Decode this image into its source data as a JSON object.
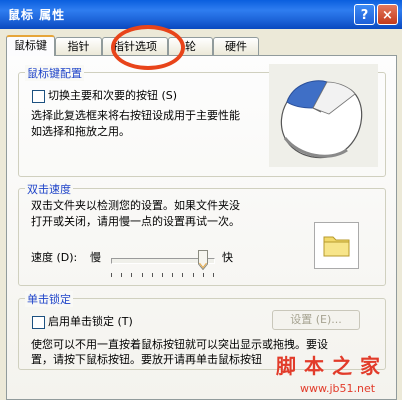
{
  "window": {
    "title": "鼠标 属性",
    "help_button": "?",
    "close_button": "×"
  },
  "tabs": [
    {
      "label": "鼠标键",
      "active": true
    },
    {
      "label": "指针",
      "active": false
    },
    {
      "label": "指针选项",
      "active": false
    },
    {
      "label": "轮",
      "active": false
    },
    {
      "label": "硬件",
      "active": false
    }
  ],
  "buttons_config": {
    "legend": "鼠标键配置",
    "swap_checkbox_label": "切换主要和次要的按钮 (S)",
    "swap_checked": false,
    "desc_line1": "选择此复选框来将右按钮设成用于主要性能",
    "desc_line2": "如选择和拖放之用。"
  },
  "double_click": {
    "legend": "双击速度",
    "desc_line1": "双击文件夹以检测您的设置。如果文件夹没",
    "desc_line2": "打开或关闭，请用慢一点的设置再试一次。",
    "speed_label": "速度 (D):",
    "slow_label": "慢",
    "fast_label": "快",
    "speed_level": 0.9
  },
  "click_lock": {
    "legend": "单击锁定",
    "checkbox_label": "启用单击锁定 (T)",
    "checked": false,
    "settings_button": "设置 (E)...",
    "desc_line1": "使您可以不用一直按着鼠标按钮就可以突出显示或拖拽。要设",
    "desc_line2": "置，请按下鼠标按钮。要放开请再单击鼠标按钮"
  },
  "watermark": {
    "brand": "脚本之家",
    "url": "www.jb51.net"
  },
  "colors": {
    "title_bar": "#0a5fde",
    "legend_text": "#1f44c9",
    "annotation_circle": "#e8441a",
    "watermark": "#e23b2a"
  }
}
